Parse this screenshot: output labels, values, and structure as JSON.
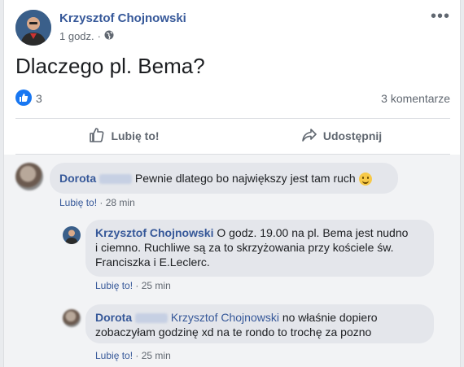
{
  "post": {
    "author": "Krzysztof Chojnowski",
    "time": "1 godz.",
    "separator": "·",
    "more": "•••",
    "text": "Dlaczego pl. Bema?",
    "likes": "3",
    "comments_count": "3 komentarze",
    "actions": {
      "like": "Lubię to!",
      "share": "Udostępnij"
    }
  },
  "comments": [
    {
      "author": "Dorota",
      "text": "Pewnie dlatego bo największy jest tam ruch",
      "emoji": "smiling-face-emoji",
      "like_label": "Lubię to!",
      "separator": "·",
      "time": "28 min"
    },
    {
      "author": "Krzysztof Chojnowski",
      "text_line1": "O godz. 19.00 na pl. Bema jest nudno",
      "text_line2": "i ciemno. Ruchliwe są za to skrzyżowania przy kościele św.",
      "text_line3": "Franciszka i E.Leclerc.",
      "like_label": "Lubię to!",
      "separator": "·",
      "time": "25 min"
    },
    {
      "author": "Dorota",
      "mention": "Krzysztof Chojnowski",
      "text_line1": "no właśnie dopiero",
      "text_line2": "zobaczyłam godzinę xd na te rondo to trochę za pozno",
      "like_label": "Lubię to!",
      "separator": "·",
      "time": "25 min"
    }
  ],
  "colors": {
    "link": "#365899",
    "accent": "#1877f2",
    "bubble": "#e4e6eb",
    "secondary": "#606770"
  }
}
